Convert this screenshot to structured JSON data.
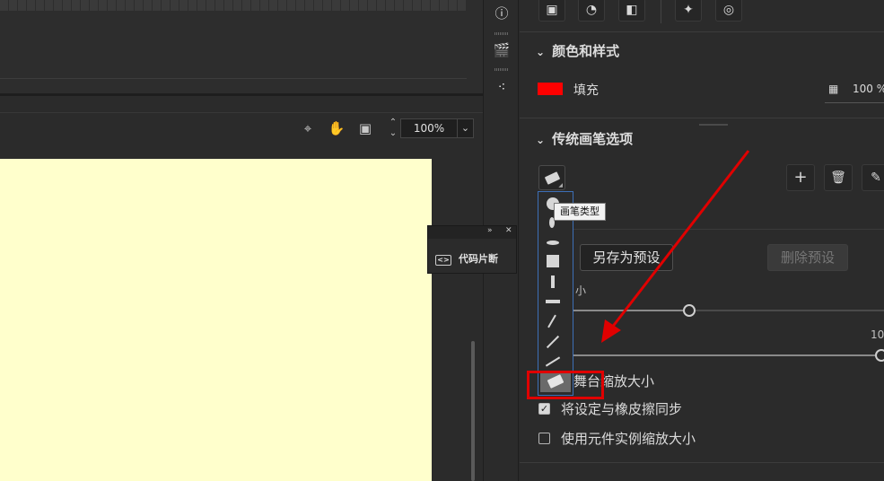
{
  "stage": {
    "zoom_value": "100%"
  },
  "snippets_panel": {
    "title": "代码片断",
    "expand_glyph": "»",
    "close_glyph": "✕",
    "icon_glyph": "<>"
  },
  "properties": {
    "color_style_section": {
      "title": "颜色和样式",
      "fill_label": "填充",
      "fill_color": "#ff0000",
      "opacity_value": "100 %"
    },
    "brush_section": {
      "title": "传统画笔选项",
      "brush_type_tooltip": "画笔类型",
      "save_preset_label": "另存为预设",
      "delete_preset_label": "删除预设",
      "size_label": "小",
      "max_value_partial": "10",
      "checkboxes": [
        {
          "label": "舞台缩放大小",
          "checked": false
        },
        {
          "label": "将设定与橡皮擦同步",
          "checked": true
        },
        {
          "label": "使用元件实例缩放大小",
          "checked": false
        }
      ]
    }
  },
  "colors": {
    "highlight_red": "#e00000",
    "stage_bg": "#ffffcc"
  }
}
